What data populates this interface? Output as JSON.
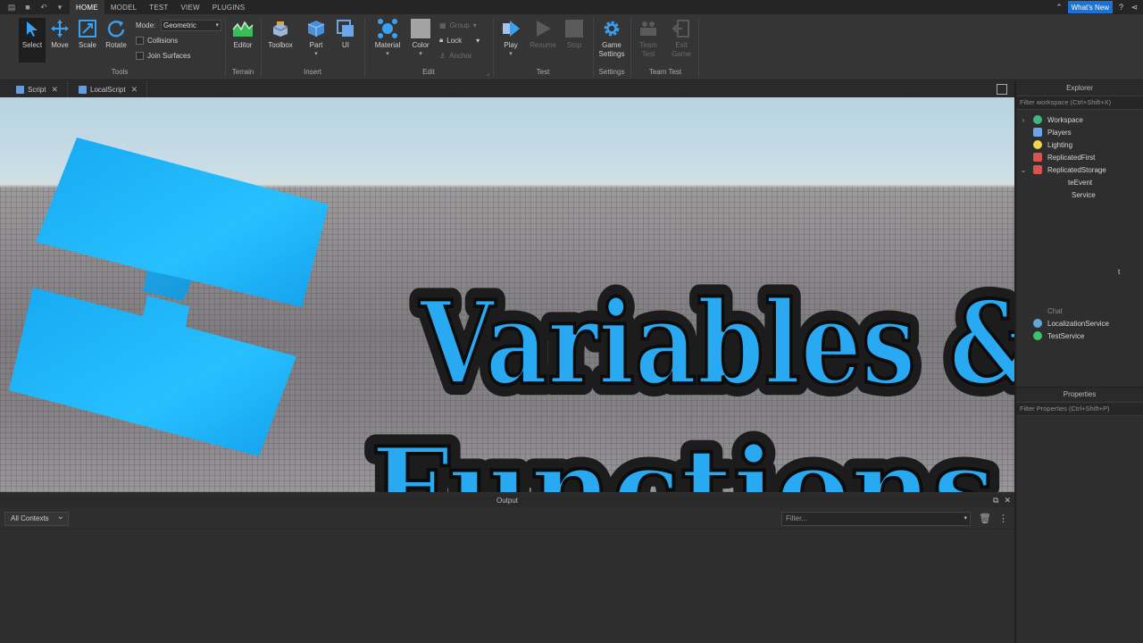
{
  "menubar": {
    "tabs": [
      {
        "label": "HOME",
        "active": true
      },
      {
        "label": "MODEL",
        "active": false
      },
      {
        "label": "TEST",
        "active": false
      },
      {
        "label": "VIEW",
        "active": false
      },
      {
        "label": "PLUGINS",
        "active": false
      }
    ],
    "whats_new": "What's New"
  },
  "ribbon": {
    "tools": {
      "select": "Select",
      "move": "Move",
      "scale": "Scale",
      "rotate": "Rotate",
      "mode_label": "Mode:",
      "mode_value": "Geometric",
      "collisions": "Collisions",
      "join_surfaces": "Join Surfaces",
      "group_label": "Tools"
    },
    "terrain": {
      "editor": "Editor",
      "group_label": "Terrain"
    },
    "insert": {
      "toolbox": "Toolbox",
      "part": "Part",
      "ui": "UI",
      "group_label": "Insert"
    },
    "edit": {
      "material": "Material",
      "color": "Color",
      "group": "Group",
      "lock": "Lock",
      "anchor": "Anchor",
      "group_label": "Edit"
    },
    "test": {
      "play": "Play",
      "resume": "Resume",
      "stop": "Stop",
      "group_label": "Test"
    },
    "settings": {
      "game_settings_1": "Game",
      "game_settings_2": "Settings",
      "group_label": "Settings"
    },
    "team_test": {
      "team_test_1": "Team",
      "team_test_2": "Test",
      "exit_game_1": "Exit",
      "exit_game_2": "Game",
      "group_label": "Team Test"
    }
  },
  "doc_tabs": [
    {
      "label": "Script"
    },
    {
      "label": "LocalScript"
    }
  ],
  "viewport": {
    "title_line1": "Variables &",
    "title_line2": "Functions"
  },
  "output": {
    "title": "Output",
    "contexts": "All Contexts",
    "filter_placeholder": "Filter..."
  },
  "explorer": {
    "title": "Explorer",
    "filter_placeholder": "Filter workspace (Ctrl+Shift+X)",
    "items": [
      {
        "label": "Workspace",
        "color": "#43b581"
      },
      {
        "label": "Players",
        "color": "#6aa6e8"
      },
      {
        "label": "Lighting",
        "color": "#f2d34b"
      },
      {
        "label": "ReplicatedFirst",
        "color": "#d9534f"
      },
      {
        "label": "ReplicatedStorage",
        "color": "#d9534f"
      },
      {
        "label": "teEvent",
        "color": "#e0a030"
      },
      {
        "label": "Service",
        "color": "#7a7a7a"
      },
      {
        "label": "t",
        "color": "#7a7a7a"
      },
      {
        "label": "Chat",
        "color": "#8a8a8a"
      },
      {
        "label": "LocalizationService",
        "color": "#5fa8e0"
      },
      {
        "label": "TestService",
        "color": "#3cc36a"
      }
    ]
  },
  "properties": {
    "title": "Properties",
    "filter_placeholder": "Filter Properties (Ctrl+Shift+P)"
  },
  "colors": {
    "accent": "#1b72d6",
    "logo_blue": "#1fb0f5",
    "title_blue": "#2aa9f3"
  }
}
